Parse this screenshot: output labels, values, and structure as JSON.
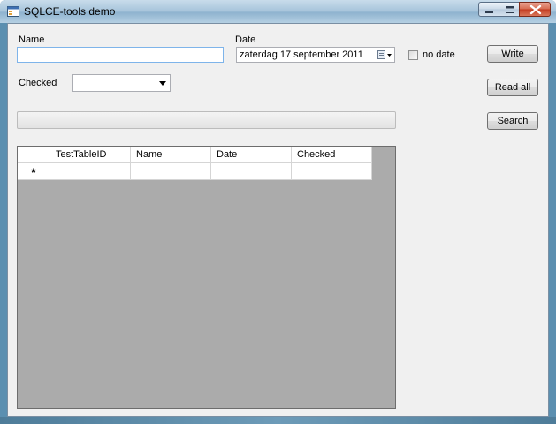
{
  "window": {
    "title": "SQLCE-tools demo"
  },
  "form": {
    "name_label": "Name",
    "name_value": "",
    "date_label": "Date",
    "date_value": "zaterdag  17 september 2011",
    "no_date_label": "no date",
    "no_date_checked": false,
    "checked_label": "Checked",
    "checked_value": ""
  },
  "buttons": {
    "write": "Write",
    "read_all": "Read all",
    "search": "Search"
  },
  "grid": {
    "columns": [
      "",
      "TestTableID",
      "Name",
      "Date",
      "Checked"
    ],
    "new_row_marker": "*"
  },
  "icons": {
    "app": "app-window-icon",
    "minimize": "minimize-icon",
    "maximize": "maximize-icon",
    "close": "close-icon",
    "calendar": "calendar-dropdown-icon",
    "combo": "chevron-down-icon"
  }
}
